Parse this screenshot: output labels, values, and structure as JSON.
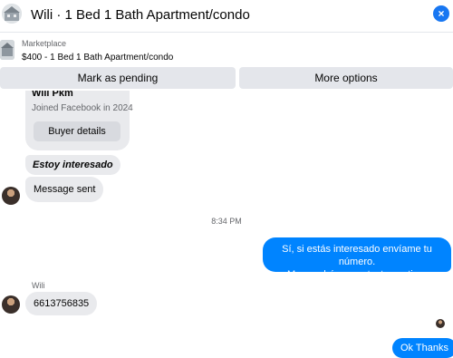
{
  "header": {
    "title": "Wili · 1 Bed 1 Bath Apartment/condo",
    "thumb_icon": "house-thumbnail-icon",
    "close_icon": "close-icon"
  },
  "listing": {
    "label": "Marketplace",
    "price_title": "$400 - 1 Bed 1 Bath Apartment/condo",
    "thumb_icon": "listing-thumbnail-icon"
  },
  "actions": {
    "pending_label": "Mark as pending",
    "more_label": "More options"
  },
  "profile_card": {
    "name": "Wili Pkm",
    "joined": "Joined Facebook in 2024",
    "button_label": "Buyer details"
  },
  "messages": {
    "estoy": "Estoy interesado",
    "sent": "Message sent",
    "timestamp": "8:34 PM",
    "out1_line1": "Sí, si estás interesado envíame tu número.",
    "out1_line2": "Me pondré en contacto contigo.",
    "sender_name": "Wili",
    "phone": "6613756835",
    "out2": "Ok Thanks"
  },
  "colors": {
    "accent": "#0084ff",
    "incoming_bubble": "#e9eaed",
    "button_bg": "#e4e6eb"
  }
}
